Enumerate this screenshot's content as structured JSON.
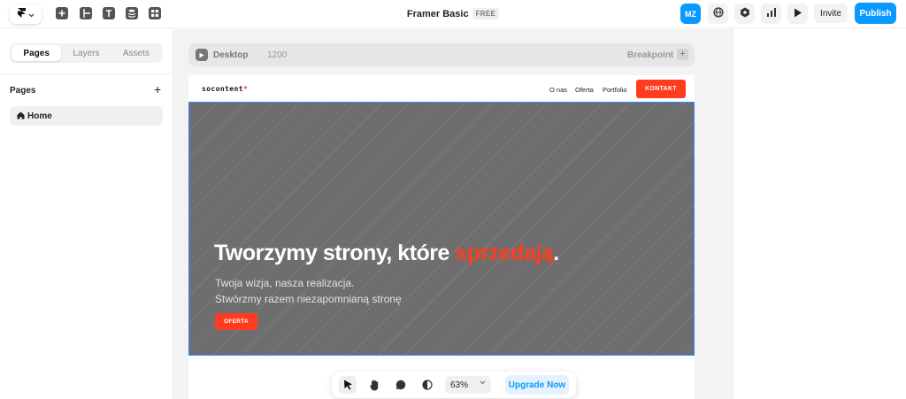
{
  "app": {
    "title": "Framer Basic",
    "plan_badge": "FREE",
    "accent_color": "#0a99ff"
  },
  "topbar": {
    "logo_icon": "framer-logo-icon",
    "tools": [
      "add-icon",
      "layout-icon",
      "text-icon",
      "cms-icon",
      "components-icon"
    ],
    "avatar_initials": "MZ",
    "right_icons": [
      "globe-icon",
      "settings-icon",
      "analytics-icon",
      "preview-play-icon"
    ],
    "invite_label": "Invite",
    "publish_label": "Publish"
  },
  "sidebar": {
    "tabs": [
      {
        "label": "Pages",
        "active": true
      },
      {
        "label": "Layers",
        "active": false
      },
      {
        "label": "Assets",
        "active": false
      }
    ],
    "section_title": "Pages",
    "add_label": "+",
    "pages": [
      {
        "label": "Home",
        "icon": "home-icon",
        "selected": true
      }
    ]
  },
  "canvas": {
    "breakpoint_bar": {
      "name": "Desktop",
      "width": "1200",
      "breakpoint_label": "Breakpoint",
      "add_label": "+"
    },
    "site": {
      "logo_text": "socontent",
      "logo_dot": "*",
      "nav_links": [
        "O nas",
        "Oferta",
        "Portfolio"
      ],
      "cta_label": "KONTAKT",
      "hero": {
        "title_main": "Tworzymy strony, które ",
        "title_accent": "sprzedają",
        "title_end": ".",
        "subtitle_line1": "Twoja wizja, nasza realizacja.",
        "subtitle_line2": "Stwórzmy razem niezapomnianą stronę",
        "button_label": "OFERTA"
      },
      "accent_color": "#ff3c1f"
    }
  },
  "bottom_toolbar": {
    "tools": [
      "cursor-icon",
      "hand-icon",
      "comment-icon",
      "dark-mode-icon"
    ],
    "zoom_value": "63%",
    "upgrade_label": "Upgrade Now"
  }
}
